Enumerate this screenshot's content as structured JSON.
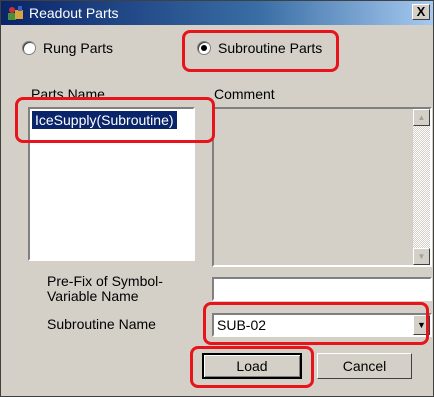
{
  "window": {
    "title": "Readout Parts",
    "close_glyph": "X"
  },
  "radios": {
    "rung_parts": {
      "label": "Rung Parts",
      "selected": false
    },
    "subroutine_parts": {
      "label": "Subroutine Parts",
      "selected": true
    }
  },
  "parts_list": {
    "header": "Parts Name",
    "items": [
      "IceSupply(Subroutine)"
    ],
    "selected_index": 0
  },
  "comment": {
    "header": "Comment",
    "value": ""
  },
  "prefix": {
    "label": "Pre-Fix of Symbol-Variable Name",
    "value": ""
  },
  "subroutine_name": {
    "label": "Subroutine Name",
    "value": "SUB-02"
  },
  "buttons": {
    "load": "Load",
    "cancel": "Cancel"
  },
  "icons": {
    "app": "readout-parts-icon",
    "scroll_up": "triangle-up",
    "scroll_down": "triangle-down",
    "dropdown": "triangle-down"
  },
  "colors": {
    "highlight": "#e8141b",
    "selection": "#0a246a",
    "face": "#d4d0c8"
  }
}
